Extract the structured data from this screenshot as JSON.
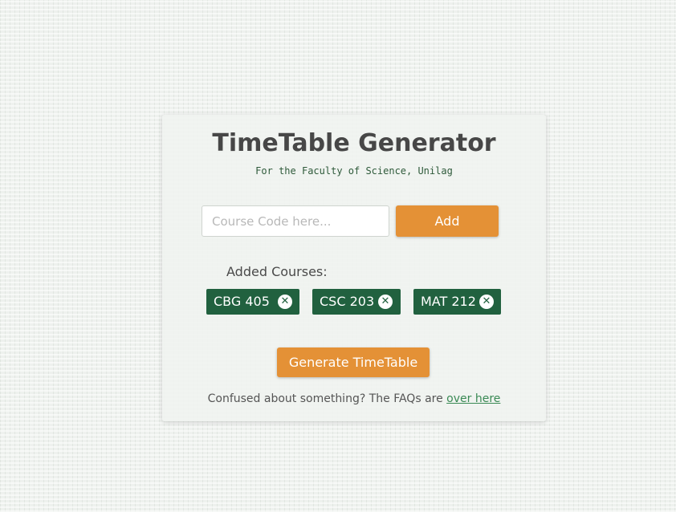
{
  "header": {
    "title": "TimeTable Generator",
    "subtitle": "For the Faculty of Science, Unilag"
  },
  "course_entry": {
    "placeholder": "Course Code here...",
    "value": "",
    "add_label": "Add"
  },
  "added_courses": {
    "label": "Added Courses:",
    "items": [
      {
        "code": "CBG 405",
        "remove_icon": "close-circle-icon"
      },
      {
        "code": "CSC 203",
        "remove_icon": "close-circle-icon"
      },
      {
        "code": "MAT 212",
        "remove_icon": "close-circle-icon"
      }
    ]
  },
  "actions": {
    "generate_label": "Generate TimeTable"
  },
  "faq": {
    "text": "Confused about something? The FAQs are ",
    "link_text": "over here"
  },
  "colors": {
    "accent_orange": "#e49136",
    "chip_green": "#21613f",
    "title_gray": "#474747",
    "link_green": "#3a8a55"
  }
}
